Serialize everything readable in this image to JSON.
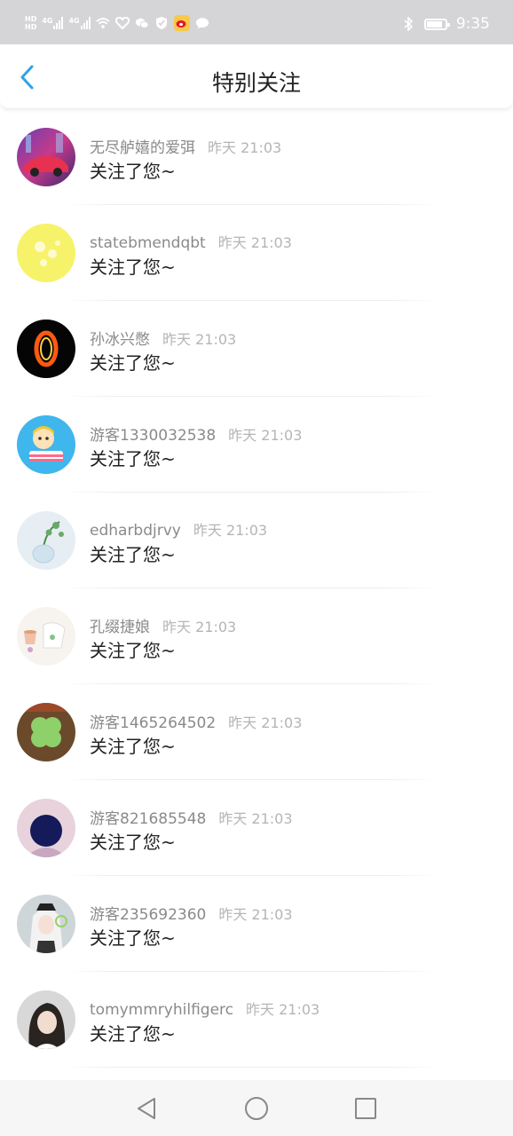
{
  "status_bar": {
    "hd_labels": [
      "HD",
      "HD"
    ],
    "network_labels": [
      "4G",
      "4G"
    ],
    "time": "9:35",
    "battery_level_percent": 85,
    "icons": [
      "wifi-icon",
      "heart-app-icon",
      "wechat-icon",
      "shield-icon",
      "weibo-icon",
      "message-icon",
      "bluetooth-icon",
      "battery-icon"
    ]
  },
  "header": {
    "title": "特别关注",
    "back_icon": "chevron-left-icon",
    "accent_color": "#2fa3e6"
  },
  "notifications": [
    {
      "name": "无尽舻嬉的爱弭",
      "time": "昨天 21:03",
      "message": "关注了您~",
      "avatar": "car-photo"
    },
    {
      "name": "statebmendqbt",
      "time": "昨天 21:03",
      "message": "关注了您~",
      "avatar": "yellow-flowers"
    },
    {
      "name": "孙冰兴憋",
      "time": "昨天 21:03",
      "message": "关注了您~",
      "avatar": "fire-zero"
    },
    {
      "name": "游客1330032538",
      "time": "昨天 21:03",
      "message": "关注了您~",
      "avatar": "cartoon-girl"
    },
    {
      "name": "edharbdjrvy",
      "time": "昨天 21:03",
      "message": "关注了您~",
      "avatar": "plant-vase"
    },
    {
      "name": "孔缀捷娘",
      "time": "昨天 21:03",
      "message": "关注了您~",
      "avatar": "teacups"
    },
    {
      "name": "游客1465264502",
      "time": "昨天 21:03",
      "message": "关注了您~",
      "avatar": "clover"
    },
    {
      "name": "游客821685548",
      "time": "昨天 21:03",
      "message": "关注了您~",
      "avatar": "dark-figure"
    },
    {
      "name": "游客235692360",
      "time": "昨天 21:03",
      "message": "关注了您~",
      "avatar": "anime-white-hair"
    },
    {
      "name": "tomymmryhilfigerc",
      "time": "昨天 21:03",
      "message": "关注了您~",
      "avatar": "girl-portrait"
    }
  ],
  "nav_bar": {
    "icons": [
      "back-triangle-icon",
      "home-circle-icon",
      "recents-square-icon"
    ]
  }
}
